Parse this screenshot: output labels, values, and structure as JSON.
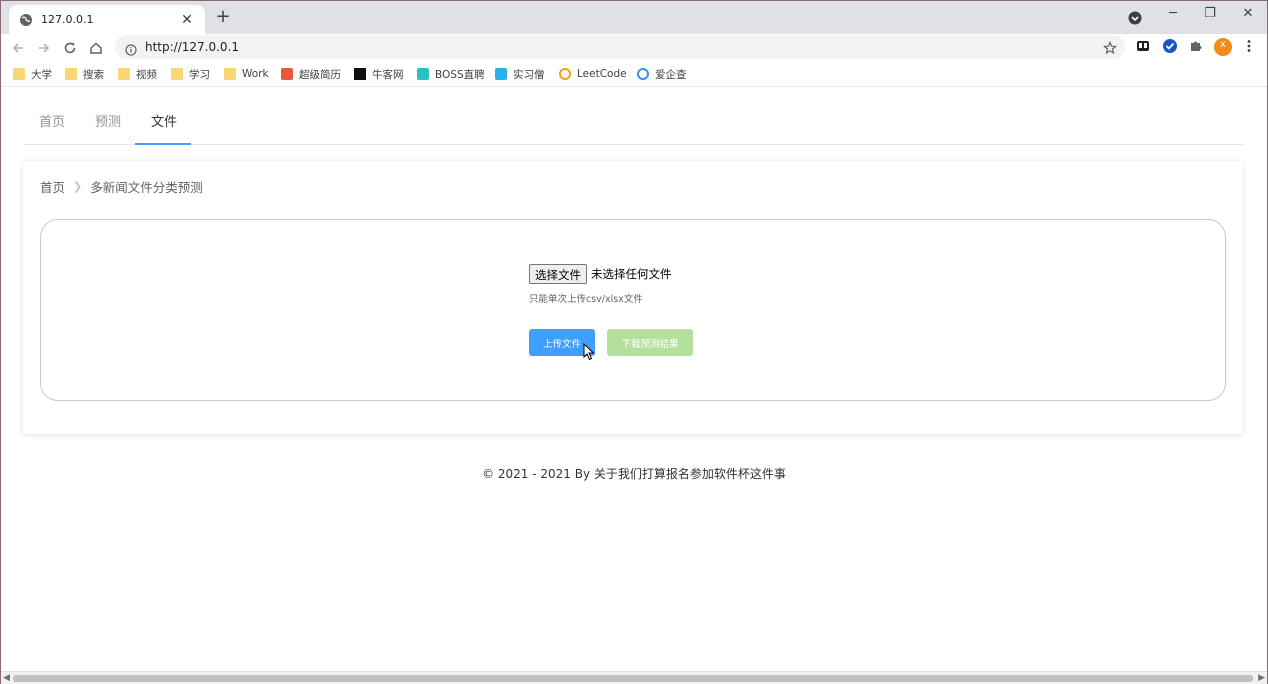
{
  "browser": {
    "tab_title": "127.0.0.1",
    "url": "http://127.0.0.1",
    "profile_initial": "x",
    "bookmarks": [
      {
        "label": "大学",
        "icon": "folder-icon"
      },
      {
        "label": "搜索",
        "icon": "folder-icon"
      },
      {
        "label": "视频",
        "icon": "folder-icon"
      },
      {
        "label": "学习",
        "icon": "folder-icon"
      },
      {
        "label": "Work",
        "icon": "folder-icon"
      },
      {
        "label": "超级简历",
        "icon": "chaoji-icon"
      },
      {
        "label": "牛客网",
        "icon": "nowcoder-icon"
      },
      {
        "label": "BOSS直聘",
        "icon": "boss-icon"
      },
      {
        "label": "实习僧",
        "icon": "shixiseng-icon"
      },
      {
        "label": "LeetCode",
        "icon": "leetcode-icon"
      },
      {
        "label": "爱企查",
        "icon": "aiqicha-icon"
      }
    ]
  },
  "nav": {
    "tabs": [
      "首页",
      "预测",
      "文件"
    ],
    "active_tab": "文件"
  },
  "breadcrumb": {
    "home": "首页",
    "current": "多新闻文件分类预测"
  },
  "upload": {
    "choose_button": "选择文件",
    "no_file_text": "未选择任何文件",
    "hint": "只能单次上传csv/xlsx文件",
    "upload_button": "上传文件",
    "download_button": "下载预测结果"
  },
  "footer": {
    "text": "© 2021 - 2021 By 关于我们打算报名参加软件杯这件事"
  },
  "colors": {
    "primary": "#409eff",
    "success_disabled": "#b3e19d",
    "profile": "#f28b18"
  }
}
